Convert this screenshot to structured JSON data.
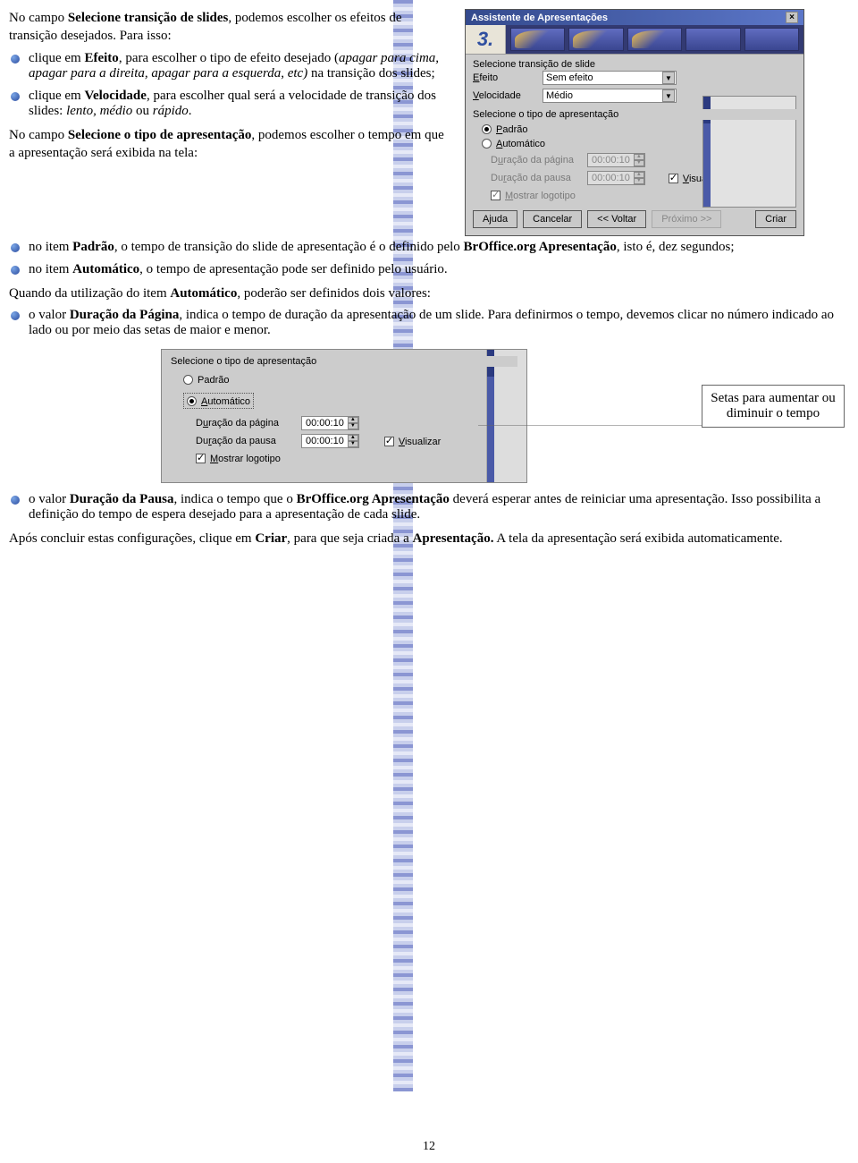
{
  "para1_a": "No campo ",
  "para1_b": "Selecione transição de slides",
  "para1_c": ", podemos escolher os efeitos de transição desejados. Para isso:",
  "bullet1_a": "clique em ",
  "bullet1_b": "Efeito",
  "bullet1_c": ", para escolher o tipo de efeito desejado (",
  "bullet1_d": "apagar para cima, apagar para a direita, apagar para a esquerda, etc)",
  "bullet1_e": " na transição dos slides;",
  "bullet2_a": "clique em ",
  "bullet2_b": "Velocidade",
  "bullet2_c": ", para escolher qual será a velocidade de transição dos slides: ",
  "bullet2_d": "lento, médio",
  "bullet2_e": " ou ",
  "bullet2_f": "rápido",
  "bullet2_g": ".",
  "para2_a": "No campo ",
  "para2_b": "Selecione o tipo de apresentação",
  "para2_c": ", podemos escolher o tempo em que a apresentação será exibida na tela:",
  "bullet3_a": "no item ",
  "bullet3_b": "Padrão",
  "bullet3_c": ", o tempo de transição do slide de apresentação é o definido pelo ",
  "bullet3_d": "BrOffice.org Apresentação",
  "bullet3_e": ", isto é, dez  segundos;",
  "bullet4_a": "no item ",
  "bullet4_b": "Automático",
  "bullet4_c": ", o tempo de apresentação pode ser definido pelo usuário.",
  "para3_a": "Quando da utilização do item ",
  "para3_b": "Automático",
  "para3_c": ", poderão ser definidos dois valores:",
  "bullet5_a": "o valor ",
  "bullet5_b": "Duração da Página",
  "bullet5_c": ", indica o tempo de duração da apresentação de um slide. Para definirmos o tempo,  devemos clicar no número indicado ao lado ou por meio das setas de maior e menor.",
  "callout": "Setas para aumentar ou diminuir o tempo",
  "bullet6_a": "o valor ",
  "bullet6_b": "Duração da Pausa",
  "bullet6_c": ", indica o tempo que o ",
  "bullet6_d": "BrOffice.org Apresentação",
  "bullet6_e": " deverá esperar antes de reiniciar uma apresentação. Isso possibilita a definição do tempo de espera desejado para a apresentação de cada slide.",
  "para4_a": "Após concluir estas configurações, clique em ",
  "para4_b": "Criar",
  "para4_c": ", para que seja criada a ",
  "para4_d": "Apresentação.",
  "para4_e": "  A tela da apresentação será exibida automaticamente.",
  "page_num": "12",
  "wizard": {
    "title": "Assistente de Apresentações",
    "step": "3.",
    "sec_trans": "Selecione transição de slide",
    "lbl_efeito": "Efeito",
    "val_efeito": "Sem efeito",
    "lbl_veloc": "Velocidade",
    "val_veloc": "Médio",
    "sec_tipo": "Selecione o tipo de apresentação",
    "radio_padrao": "Padrão",
    "radio_auto": "Automático",
    "lbl_dur_pag": "Duração da página",
    "val_dur_pag": "00:00:10",
    "lbl_dur_pausa": "Duração da pausa",
    "val_dur_pausa": "00:00:10",
    "chk_logo": "Mostrar logotipo",
    "chk_visualizar": "Visualizar",
    "btn_ajuda": "Ajuda",
    "btn_cancelar": "Cancelar",
    "btn_voltar": "<< Voltar",
    "btn_proximo": "Próximo >>",
    "btn_criar": "Criar"
  },
  "inset2": {
    "sec_tipo": "Selecione o tipo de apresentação",
    "radio_padrao": "Padrão",
    "radio_auto": "Automático",
    "lbl_dur_pag": "Duração da página",
    "val_dur_pag": "00:00:10",
    "lbl_dur_pausa": "Duração da pausa",
    "val_dur_pausa": "00:00:10",
    "chk_visualizar": "Visualizar",
    "chk_logo": "Mostrar logotipo"
  }
}
